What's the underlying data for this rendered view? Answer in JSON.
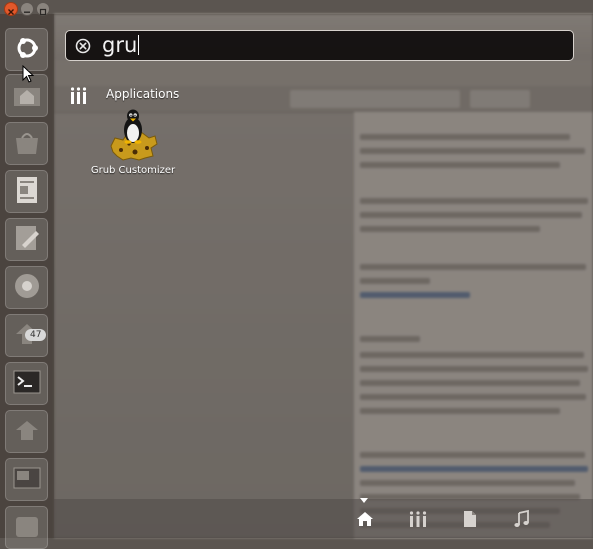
{
  "search": {
    "query": "gru"
  },
  "category": {
    "label": "Applications"
  },
  "results": [
    {
      "label": "Grub Customizer",
      "icon": "grub-customizer-penguin-icon"
    }
  ],
  "launcher": {
    "badge_count": "47",
    "items": [
      {
        "name": "ubuntu-dash-icon"
      },
      {
        "name": "home-folder-icon"
      },
      {
        "name": "software-center-icon"
      },
      {
        "name": "document-viewer-icon"
      },
      {
        "name": "text-editor-icon"
      },
      {
        "name": "chromium-icon"
      },
      {
        "name": "update-manager-icon"
      },
      {
        "name": "terminal-icon"
      },
      {
        "name": "network-icon"
      },
      {
        "name": "workspace-switcher-icon"
      },
      {
        "name": "trash-icon"
      }
    ]
  },
  "lenses": [
    {
      "name": "home-lens-icon"
    },
    {
      "name": "applications-lens-icon"
    },
    {
      "name": "files-lens-icon"
    },
    {
      "name": "music-lens-icon"
    }
  ],
  "colors": {
    "search_bg": "#0f0c0c",
    "launcher_bg": "#463f3a",
    "close_button": "#e2582a"
  }
}
